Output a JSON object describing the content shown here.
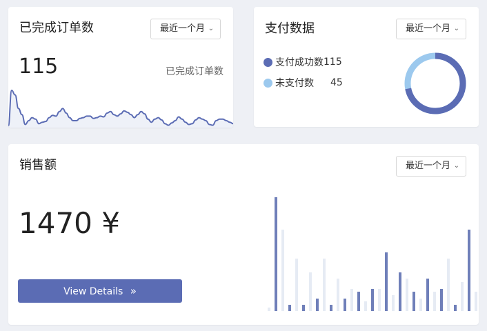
{
  "orders": {
    "title": "已完成订单数",
    "range": "最近一个月",
    "value": "115",
    "label": "已完成订单数",
    "sparkline": [
      3,
      50,
      44,
      26,
      18,
      5,
      10,
      14,
      12,
      6,
      8,
      9,
      14,
      17,
      16,
      22,
      26,
      20,
      14,
      10,
      10,
      13,
      14,
      16,
      16,
      13,
      14,
      16,
      15,
      20,
      22,
      18,
      16,
      19,
      23,
      21,
      18,
      14,
      18,
      22,
      19,
      12,
      8,
      12,
      14,
      11,
      6,
      4,
      7,
      10,
      15,
      12,
      8,
      5,
      6,
      11,
      14,
      12,
      10,
      5,
      4,
      10,
      12,
      12,
      10,
      8,
      6
    ]
  },
  "payments": {
    "title": "支付数据",
    "range": "最近一个月",
    "legend": [
      {
        "label": "支付成功数",
        "value": "115",
        "color": "#5b6cb4"
      },
      {
        "label": "未支付数",
        "value": "45",
        "color": "#9cc9ee"
      }
    ],
    "success": 115,
    "unpaid": 45
  },
  "sales": {
    "title": "销售额",
    "range": "最近一个月",
    "value": "1470 ¥",
    "button_label": "View Details",
    "button_icon": "double-chevron-right-icon",
    "bars": [
      {
        "v": 5,
        "s": "light"
      },
      {
        "v": 165,
        "s": "dark"
      },
      {
        "v": 118,
        "s": "light"
      },
      {
        "v": 9,
        "s": "dark"
      },
      {
        "v": 76,
        "s": "light"
      },
      {
        "v": 9,
        "s": "dark"
      },
      {
        "v": 56,
        "s": "light"
      },
      {
        "v": 18,
        "s": "dark"
      },
      {
        "v": 76,
        "s": "light"
      },
      {
        "v": 9,
        "s": "dark"
      },
      {
        "v": 47,
        "s": "light"
      },
      {
        "v": 18,
        "s": "dark"
      },
      {
        "v": 32,
        "s": "light"
      },
      {
        "v": 28,
        "s": "dark"
      },
      {
        "v": 14,
        "s": "light"
      },
      {
        "v": 32,
        "s": "dark"
      },
      {
        "v": 32,
        "s": "light"
      },
      {
        "v": 85,
        "s": "dark"
      },
      {
        "v": 23,
        "s": "light"
      },
      {
        "v": 56,
        "s": "dark"
      },
      {
        "v": 47,
        "s": "light"
      },
      {
        "v": 28,
        "s": "dark"
      },
      {
        "v": 18,
        "s": "light"
      },
      {
        "v": 47,
        "s": "dark"
      },
      {
        "v": 28,
        "s": "light"
      },
      {
        "v": 32,
        "s": "dark"
      },
      {
        "v": 76,
        "s": "light"
      },
      {
        "v": 9,
        "s": "dark"
      },
      {
        "v": 42,
        "s": "light"
      },
      {
        "v": 118,
        "s": "dark"
      },
      {
        "v": 28,
        "s": "light"
      }
    ],
    "bar_colors": {
      "dark": "#6f7fb9",
      "light": "#e6ebf4"
    }
  }
}
